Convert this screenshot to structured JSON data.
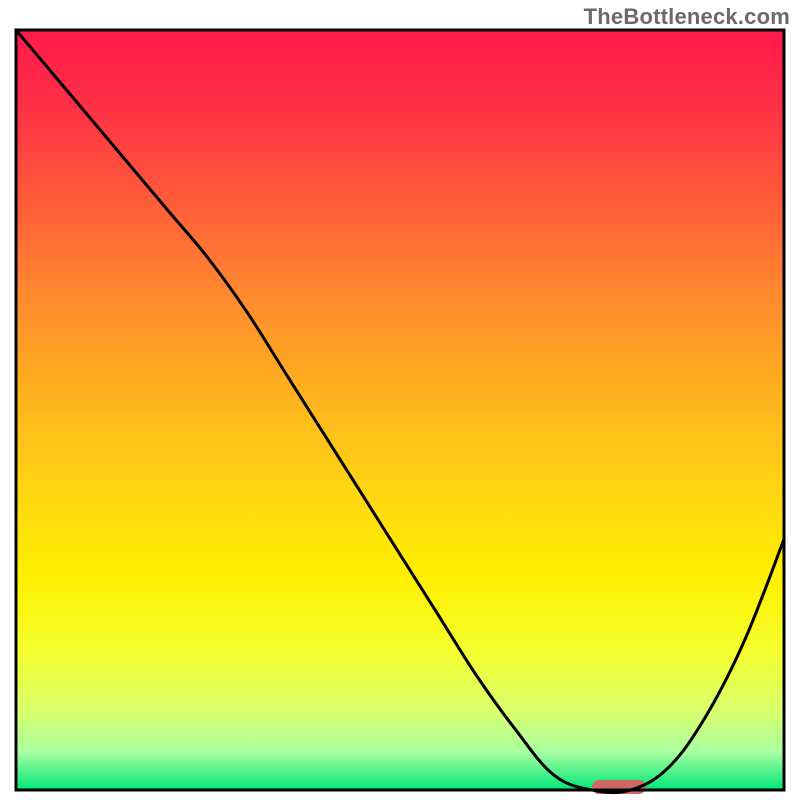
{
  "watermark": "TheBottleneck.com",
  "chart_data": {
    "type": "line",
    "title": "",
    "xlabel": "",
    "ylabel": "",
    "xlim": [
      0,
      100
    ],
    "ylim": [
      0,
      100
    ],
    "x": [
      0,
      5,
      10,
      15,
      20,
      25,
      30,
      35,
      40,
      45,
      50,
      55,
      60,
      65,
      70,
      75,
      80,
      85,
      90,
      95,
      100
    ],
    "values": [
      100,
      94,
      88,
      82,
      76,
      70,
      63,
      55,
      47,
      39,
      31,
      23,
      15,
      8,
      2,
      0,
      0,
      3,
      10,
      20,
      33
    ],
    "annotation_bar": {
      "x_start": 75,
      "x_end": 82,
      "y": 0,
      "color": "#d06868"
    },
    "gradient_stops": [
      {
        "offset": 0.0,
        "color": "#ff1a4b"
      },
      {
        "offset": 0.1,
        "color": "#ff3046"
      },
      {
        "offset": 0.22,
        "color": "#ff5a3a"
      },
      {
        "offset": 0.35,
        "color": "#ff8a2e"
      },
      {
        "offset": 0.48,
        "color": "#ffb21e"
      },
      {
        "offset": 0.6,
        "color": "#ffd414"
      },
      {
        "offset": 0.72,
        "color": "#fff000"
      },
      {
        "offset": 0.82,
        "color": "#f4ff30"
      },
      {
        "offset": 0.9,
        "color": "#d6ff70"
      },
      {
        "offset": 0.95,
        "color": "#a8ffa0"
      },
      {
        "offset": 1.0,
        "color": "#00e676"
      }
    ],
    "frame_color": "#000000",
    "line_color": "#000000",
    "line_width": 3
  }
}
